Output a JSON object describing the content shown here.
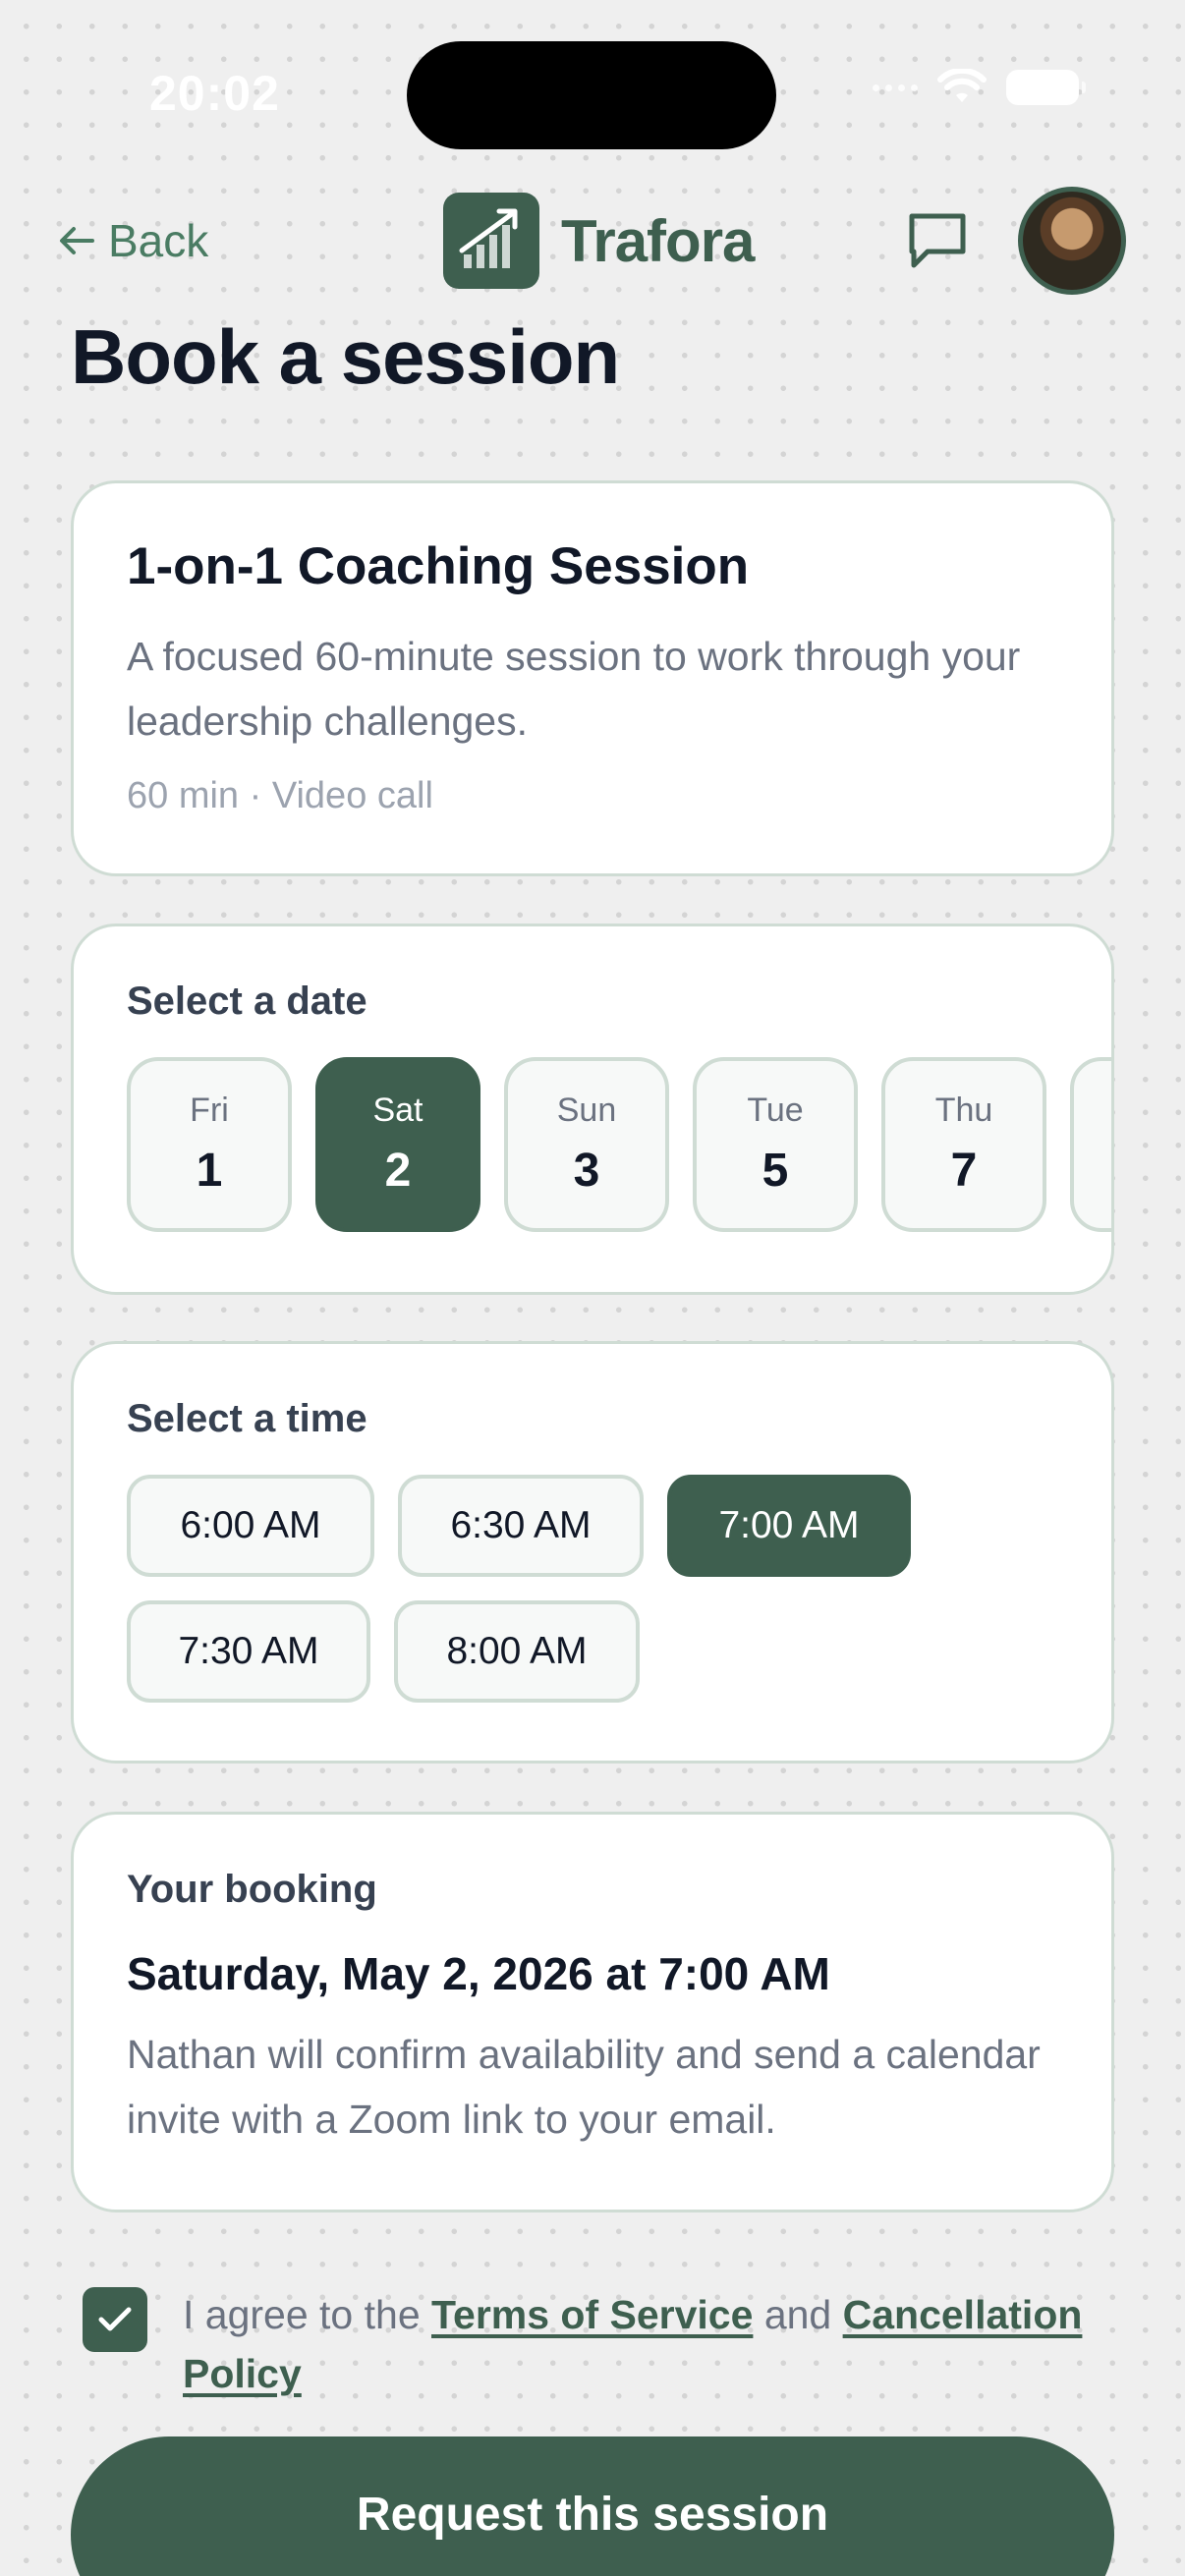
{
  "status_bar": {
    "time": "20:02"
  },
  "nav": {
    "back_label": "Back",
    "brand_name": "Trafora"
  },
  "page": {
    "title": "Book a session"
  },
  "session": {
    "title": "1-on-1 Coaching Session",
    "description": "A focused 60-minute session to work through your leadership challenges.",
    "meta": "60 min · Video call"
  },
  "dates": {
    "label": "Select a date",
    "items": [
      {
        "dow": "Fri",
        "day": "1"
      },
      {
        "dow": "Sat",
        "day": "2"
      },
      {
        "dow": "Sun",
        "day": "3"
      },
      {
        "dow": "Tue",
        "day": "5"
      },
      {
        "dow": "Thu",
        "day": "7"
      }
    ],
    "selected_index": 1
  },
  "times": {
    "label": "Select a time",
    "items": [
      "6:00 AM",
      "6:30 AM",
      "7:00 AM",
      "7:30 AM",
      "8:00 AM"
    ],
    "selected_index": 2
  },
  "booking": {
    "label": "Your booking",
    "when": "Saturday, May 2, 2026 at 7:00 AM",
    "note": "Nathan will confirm availability and send a calendar invite with a Zoom link to your email."
  },
  "agreement": {
    "checked": true,
    "prefix": "I agree to the ",
    "terms_link": "Terms of Service",
    "middle": " and ",
    "cancellation_link": "Cancellation Policy"
  },
  "cta": {
    "label": "Request this session"
  },
  "colors": {
    "brand": "#3e5f4f",
    "border": "#cfdcd4",
    "muted": "#6b7280"
  }
}
